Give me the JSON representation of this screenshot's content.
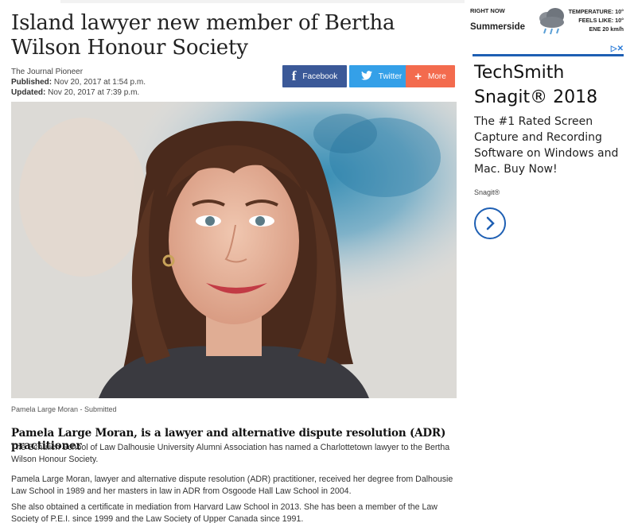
{
  "article": {
    "headline": "Island lawyer new member of Bertha Wilson Honour Society",
    "source": "The Journal Pioneer",
    "published_label": "Published:",
    "published": "Nov 20, 2017 at 1:54 p.m.",
    "updated_label": "Updated:",
    "updated": "Nov 20, 2017 at 7:39 p.m.",
    "caption": "Pamela Large Moran - Submitted",
    "subhead": "Pamela Large Moran, is a lawyer and alternative dispute resolution (ADR) practitioner",
    "paragraphs": [
      "The Schulich School of Law Dalhousie University Alumni Association has named a Charlottetown lawyer to the Bertha Wilson Honour Society.",
      "Pamela Large Moran, lawyer and alternative dispute resolution (ADR) practitioner, received her degree from Dalhousie Law School in 1989 and her masters in law in ADR from Osgoode Hall Law School in 2004.",
      "She also obtained a certificate in mediation from Harvard Law School in 2013. She has been a member of the Law Society of P.E.I. since 1999 and the Law Society of Upper Canada since 1991."
    ]
  },
  "share": {
    "facebook": "Facebook",
    "twitter": "Twitter",
    "more": "More",
    "colors": {
      "facebook": "#3b5998",
      "twitter": "#34a0e8",
      "more": "#f36b4e"
    }
  },
  "weather": {
    "right_now": "RIGHT NOW",
    "city": "Summerside",
    "temperature": "TEMPERATURE: 10°",
    "feels_like": "FEELS LIKE: 10°",
    "wind": "ENE 20 km/h",
    "icon": "rain-cloud-icon"
  },
  "ad": {
    "title_line1": "TechSmith",
    "title_line2": "Snagit® 2018",
    "body": "The #1 Rated Screen Capture and Recording Software on Windows and Mac. Buy Now!",
    "brand": "Snagit®",
    "accent": "#1e5fb3"
  }
}
